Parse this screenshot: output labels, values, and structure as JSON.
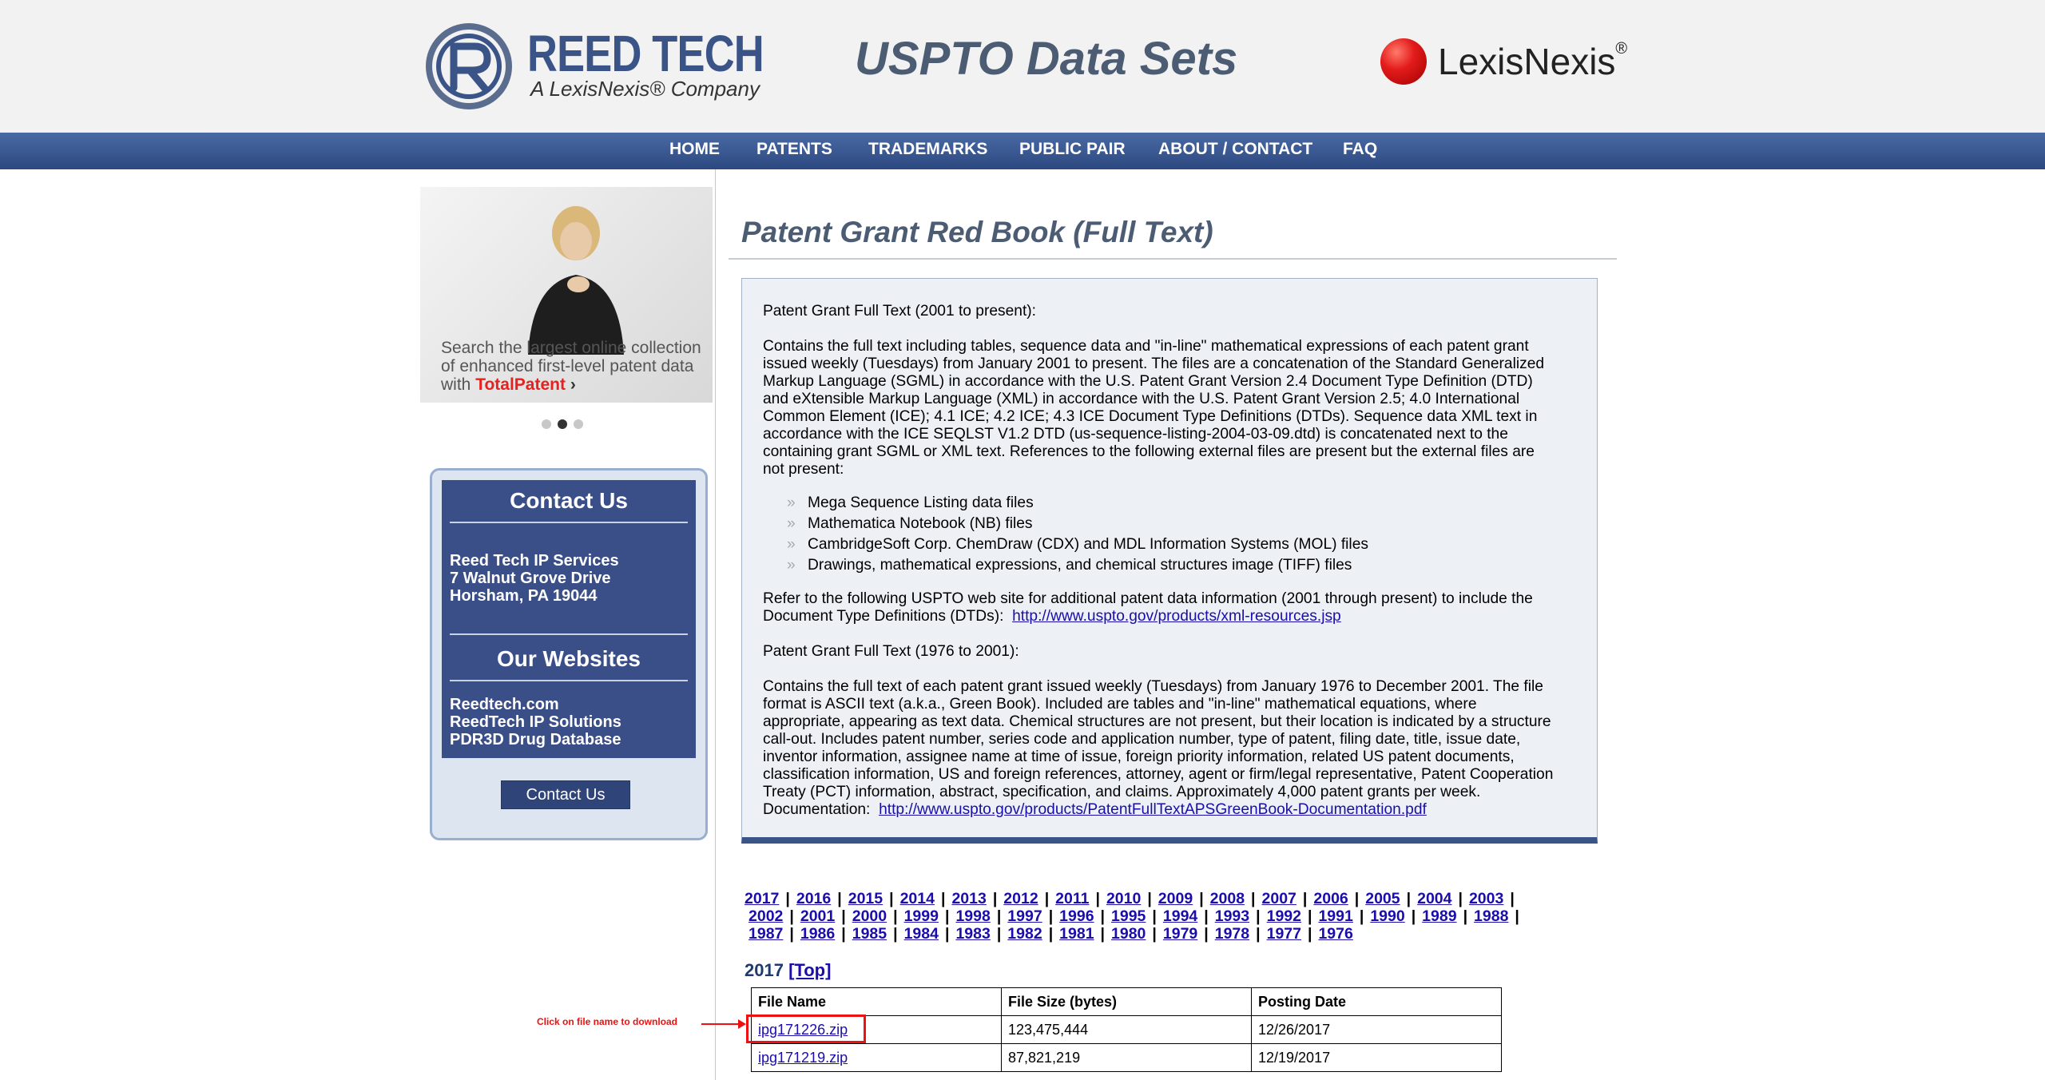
{
  "header": {
    "brand_title": "REED TECH",
    "brand_subtitle": "A LexisNexis® Company",
    "site_title": "USPTO Data Sets",
    "partner_logo": "LexisNexis",
    "partner_mark": "®"
  },
  "nav": [
    {
      "label": "HOME"
    },
    {
      "label": "PATENTS"
    },
    {
      "label": "TRADEMARKS"
    },
    {
      "label": "PUBLIC PAIR"
    },
    {
      "label": "ABOUT / CONTACT"
    },
    {
      "label": "FAQ"
    }
  ],
  "promo": {
    "line1": "Search the largest online collection",
    "line2": "of enhanced first-level patent data",
    "line3_prefix": "with ",
    "line3_brand": "TotalPatent",
    "chevron": "›",
    "active_dot": 2
  },
  "sidebar": {
    "contact_heading": "Contact Us",
    "address_1": "Reed Tech IP Services",
    "address_2": "7 Walnut Grove Drive",
    "address_3": "Horsham, PA 19044",
    "websites_heading": "Our Websites",
    "site_1": "Reedtech.com",
    "site_2": "ReedTech IP Solutions",
    "site_3": "PDR3D Drug Database",
    "contact_button": "Contact Us"
  },
  "main": {
    "page_title": "Patent Grant Red Book (Full Text)",
    "section1_title": "Patent Grant Full Text (2001 to present):",
    "section1_lines": [
      "Contains the full text including tables, sequence data and \"in-line\" mathematical expressions of each patent grant",
      "issued weekly (Tuesdays) from January 2001 to present. The files are a concatenation of the Standard Generalized",
      "Markup Language (SGML) in accordance with the U.S. Patent Grant Version 2.4 Document Type Definition (DTD)",
      "and eXtensible Markup Language (XML) in accordance with the U.S. Patent Grant Version 2.5; 4.0 International",
      "Common Element (ICE); 4.1 ICE; 4.2 ICE; 4.3 ICE Document Type Definitions (DTDs). Sequence data XML text in",
      "accordance with the ICE SEQLST V1.2 DTD (us-sequence-listing-2004-03-09.dtd) is concatenated next to the",
      "containing grant SGML or XML text. References to the following external files are present but the external files are",
      "not present:"
    ],
    "bullets": [
      "Mega Sequence Listing data files",
      "Mathematica Notebook (NB) files",
      "CambridgeSoft Corp. ChemDraw (CDX) and MDL Information Systems (MOL) files",
      "Drawings, mathematical expressions, and chemical structures image (TIFF) files"
    ],
    "refer_line1": "Refer to the following USPTO web site for additional patent data information (2001 through present) to include the",
    "refer_line2": "Document Type Definitions (DTDs):",
    "refer_link": "http://www.uspto.gov/products/xml-resources.jsp",
    "section2_title": "Patent Grant Full Text (1976 to 2001):",
    "section2_lines": [
      "Contains the full text of each patent grant issued weekly (Tuesdays) from January 1976 to December 2001. The file",
      "format is ASCII text (a.k.a., Green Book). Included are tables and \"in-line\" mathematical equations, where",
      "appropriate, appearing as text data. Chemical structures are not present, but their location is indicated by a structure",
      "call-out. Includes patent number, series code and application number, type of patent, filing date, title, issue date,",
      "inventor information, assignee name at time of issue, foreign priority information, related US patent documents,",
      "classification information, US and foreign references, attorney, agent or firm/legal representative, Patent Cooperation",
      "Treaty (PCT) information, abstract, specification, and claims. Approximately 4,000 patent grants per week."
    ],
    "doc_label": "Documentation:",
    "doc_link": "http://www.uspto.gov/products/PatentFullTextAPSGreenBook-Documentation.pdf"
  },
  "years": {
    "row1": [
      "2017",
      "2016",
      "2015",
      "2014",
      "2013",
      "2012",
      "2011",
      "2010",
      "2009",
      "2008",
      "2007",
      "2006",
      "2005",
      "2004",
      "2003"
    ],
    "row2": [
      "2002",
      "2001",
      "2000",
      "1999",
      "1998",
      "1997",
      "1996",
      "1995",
      "1994",
      "1993",
      "1992",
      "1991",
      "1990",
      "1989",
      "1988"
    ],
    "row3": [
      "1987",
      "1986",
      "1985",
      "1984",
      "1983",
      "1982",
      "1981",
      "1980",
      "1979",
      "1978",
      "1977",
      "1976"
    ],
    "separator": "|"
  },
  "files": {
    "year_heading": "2017",
    "top_link": "[Top]",
    "headers": [
      "File Name",
      "File Size (bytes)",
      "Posting Date"
    ],
    "rows": [
      {
        "name": "ipg171226.zip",
        "size": "123,475,444",
        "date": "12/26/2017"
      },
      {
        "name": "ipg171219.zip",
        "size": "87,821,219",
        "date": "12/19/2017"
      }
    ]
  },
  "annotation": {
    "text": "Click on file name to download",
    "color": "#ee1111"
  },
  "colors": {
    "nav_blue": "#3b5488",
    "title_gray": "#4c5d73",
    "link_blue": "#1a0dab"
  }
}
